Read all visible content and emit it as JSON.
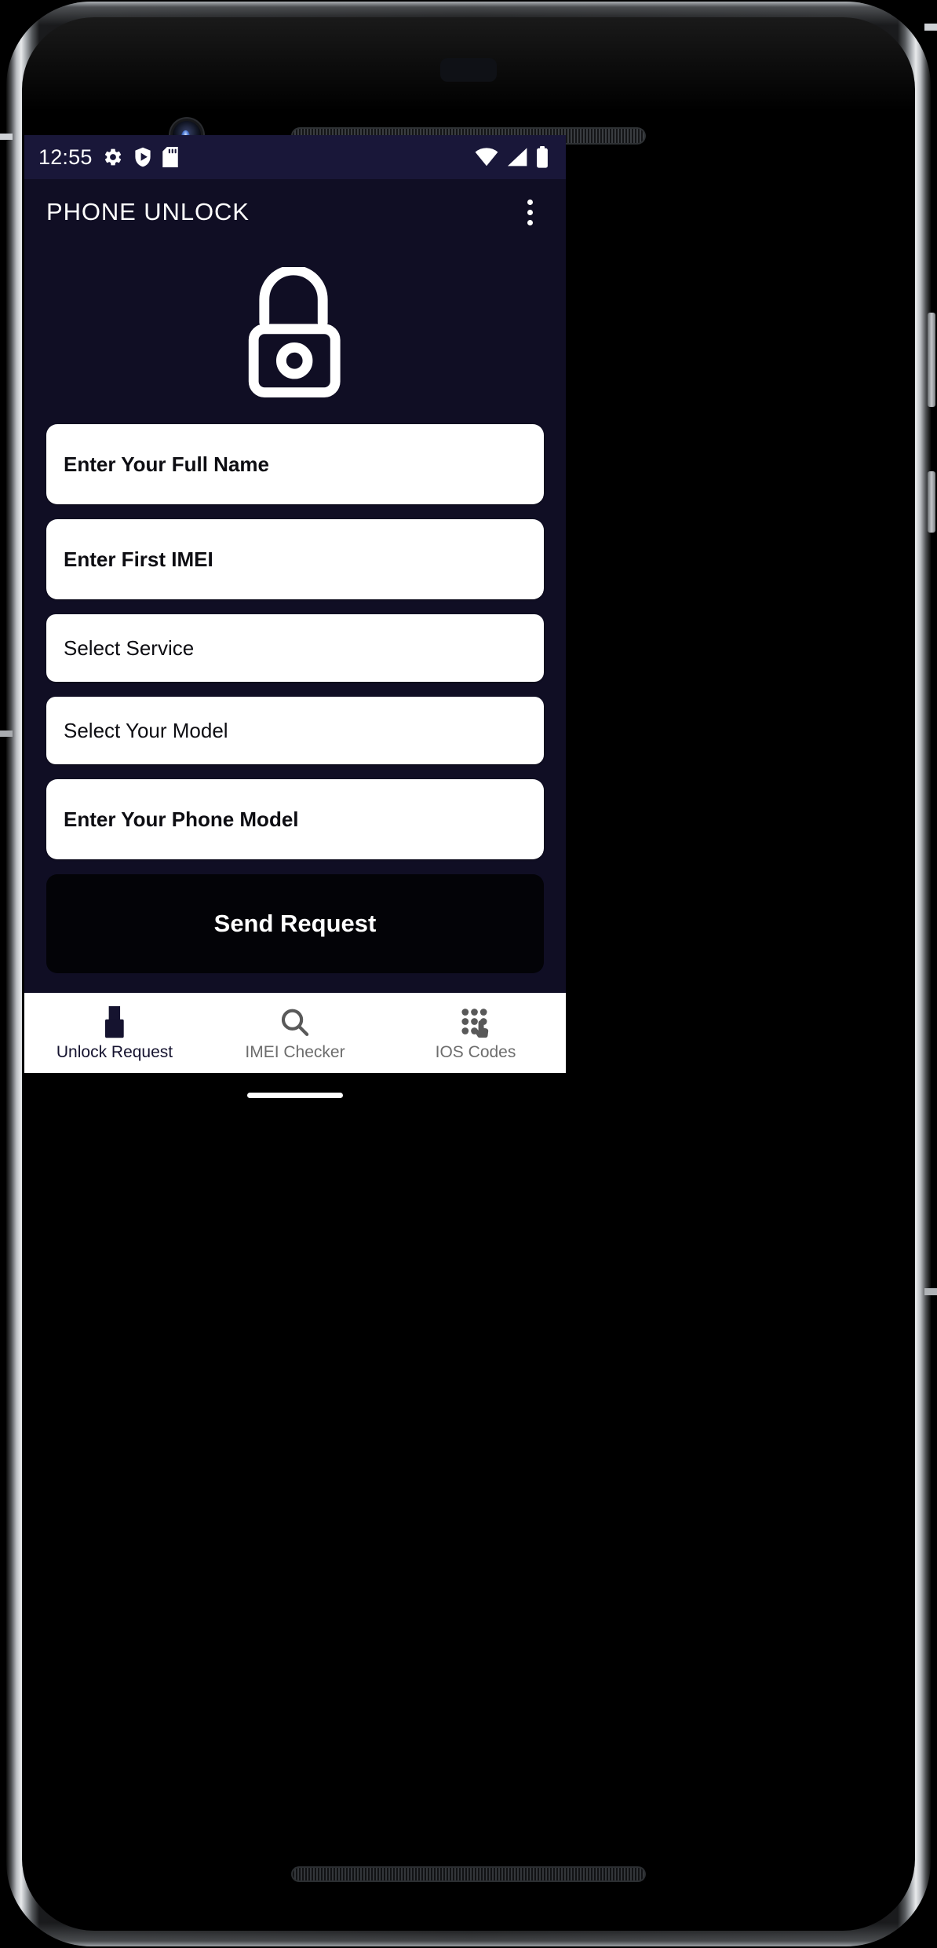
{
  "device": {
    "frame_color": "#0b0b0c",
    "glass_color": "#000000"
  },
  "statusbar": {
    "time": "12:55",
    "background": "#191739",
    "left_icons": [
      "gear-icon",
      "play-protect-shield-icon",
      "sd-card-icon"
    ],
    "right_icons": [
      "wifi-icon",
      "cell-signal-icon",
      "battery-icon"
    ]
  },
  "appbar": {
    "title": "PHONE UNLOCK",
    "background": "#100E24",
    "overflow_icon": "more-vertical-icon"
  },
  "hero": {
    "icon": "open-padlock-icon",
    "icon_color": "#ffffff"
  },
  "form": {
    "fields": [
      {
        "label": "Enter Your Full Name",
        "kind": "input",
        "bold": true
      },
      {
        "label": "Enter First IMEI",
        "kind": "input",
        "bold": true
      },
      {
        "label": "Select Service",
        "kind": "spinner",
        "bold": false
      },
      {
        "label": "Select Your Model",
        "kind": "spinner",
        "bold": false
      },
      {
        "label": "Enter Your Phone Model",
        "kind": "input",
        "bold": true
      }
    ],
    "submit_label": "Send Request",
    "submit_background": "#030307",
    "field_background": "#ffffff",
    "field_text_color": "#0d0d12"
  },
  "bottomnav": {
    "background": "#ffffff",
    "active_color": "#15132f",
    "inactive_color": "#6d6d6d",
    "items": [
      {
        "label": "Unlock Request",
        "icon": "padlock-icon",
        "active": true
      },
      {
        "label": "IMEI Checker",
        "icon": "search-icon",
        "active": false
      },
      {
        "label": "IOS Codes",
        "icon": "dialpad-tap-icon",
        "active": false
      }
    ]
  },
  "gesture": {
    "pill_color": "#ffffff"
  }
}
